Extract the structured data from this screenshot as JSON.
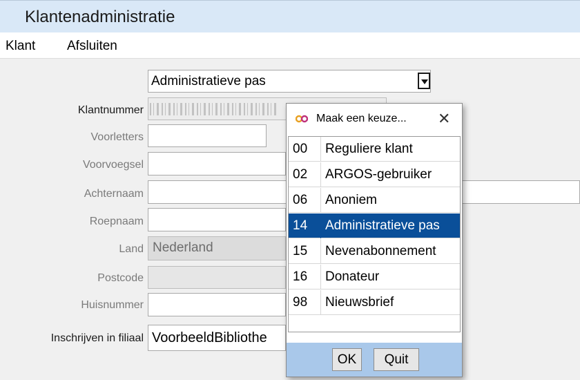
{
  "app": {
    "title": "Klantenadministratie"
  },
  "menu": {
    "items": [
      "Klant",
      "Afsluiten"
    ]
  },
  "form": {
    "type_select": "Administratieve pas",
    "fields": {
      "klantnummer": {
        "label": "Klantnummer"
      },
      "voorletters": {
        "label": "Voorletters",
        "value": ""
      },
      "voorvoegsel": {
        "label": "Voorvoegsel",
        "value": ""
      },
      "achternaam": {
        "label": "Achternaam",
        "value": ""
      },
      "roepnaam": {
        "label": "Roepnaam",
        "value": ""
      },
      "land": {
        "label": "Land",
        "value": "Nederland"
      },
      "postcode": {
        "label": "Postcode",
        "value": ""
      },
      "huisnummer": {
        "label": "Huisnummer",
        "value": ""
      },
      "filiaal": {
        "label": "Inschrijven in filiaal",
        "value": "VoorbeeldBibliothe"
      }
    }
  },
  "popup": {
    "title": "Maak een keuze...",
    "close_icon": "close-icon",
    "options": [
      {
        "code": "00",
        "name": "Reguliere klant"
      },
      {
        "code": "02",
        "name": "ARGOS-gebruiker"
      },
      {
        "code": "06",
        "name": "Anoniem"
      },
      {
        "code": "14",
        "name": "Administratieve pas",
        "selected": true
      },
      {
        "code": "15",
        "name": "Nevenabonnement"
      },
      {
        "code": "16",
        "name": "Donateur"
      },
      {
        "code": "98",
        "name": "Nieuwsbrief"
      }
    ],
    "ok_label": "OK",
    "quit_label": "Quit"
  },
  "colors": {
    "selection": "#0a4f99",
    "titlebar": "#d9e8f7",
    "popup_footer": "#a9c8ea"
  }
}
